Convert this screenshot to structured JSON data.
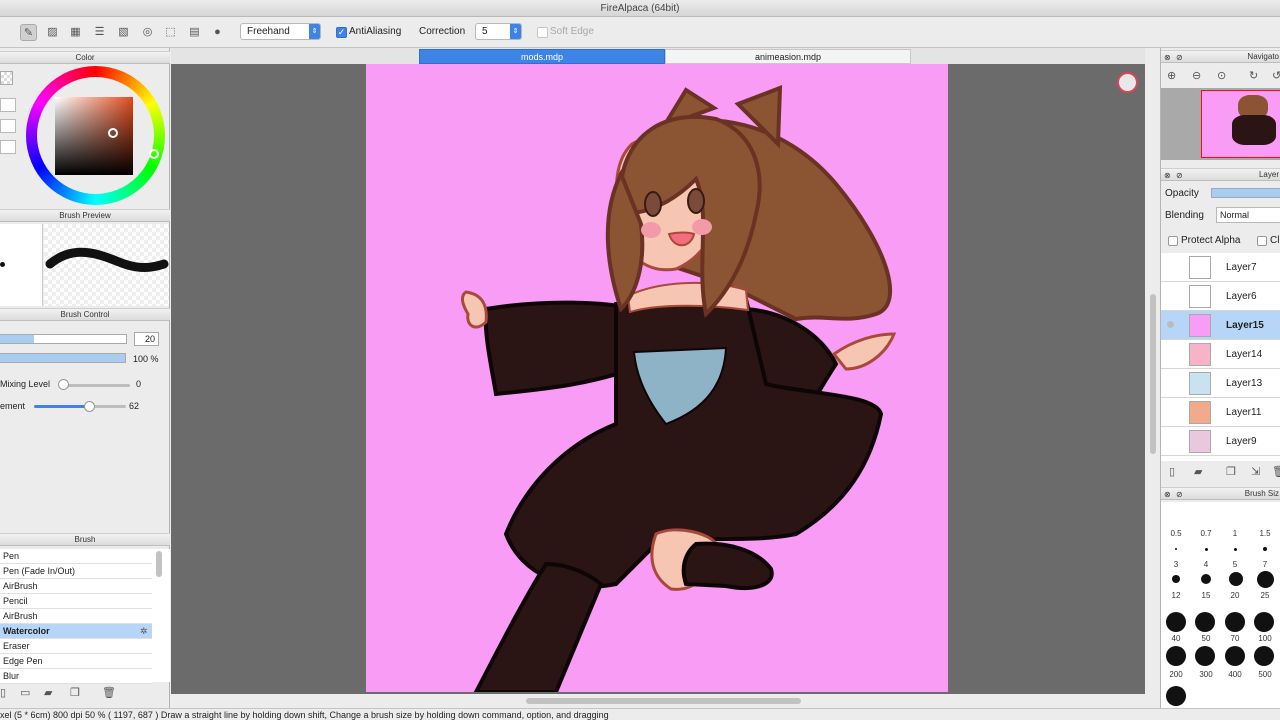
{
  "app": {
    "title": "FireAlpaca (64bit)"
  },
  "toolbar": {
    "mode_select": "Freehand",
    "antialias_label": "AntiAliasing",
    "antialias_checked": true,
    "correction_label": "Correction",
    "correction_value": "5",
    "soft_edge_label": "Soft Edge",
    "soft_edge_checked": false
  },
  "tabs": [
    {
      "label": "mods.mdp",
      "active": true
    },
    {
      "label": "animeasion.mdp",
      "active": false
    }
  ],
  "left": {
    "color_title": "Color",
    "brush_preview_title": "Brush Preview",
    "brush_control_title": "Brush Control",
    "brush_size_value": "20",
    "opacity_value": "100 %",
    "mixing_label": "Mixing Level",
    "mixing_value": "0",
    "ement_label": "ement",
    "ement_value": "62",
    "brush_title": "Brush",
    "brushes": [
      {
        "label": "Pen",
        "selected": false
      },
      {
        "label": "Pen (Fade In/Out)",
        "selected": false
      },
      {
        "label": "AirBrush",
        "selected": false
      },
      {
        "label": "Pencil",
        "selected": false
      },
      {
        "label": "AirBrush",
        "selected": false
      },
      {
        "label": "Watercolor",
        "selected": true
      },
      {
        "label": "Eraser",
        "selected": false
      },
      {
        "label": "Edge Pen",
        "selected": false
      },
      {
        "label": "Blur",
        "selected": false
      }
    ]
  },
  "right": {
    "navigator_title": "Navigato",
    "layer_title": "Layer",
    "opacity_label": "Opacity",
    "blending_label": "Blending",
    "blending_value": "Normal",
    "protect_alpha_label": "Protect Alpha",
    "clipping_label": "Clipp",
    "layers": [
      {
        "name": "Layer7",
        "selected": false
      },
      {
        "name": "Layer6",
        "selected": false
      },
      {
        "name": "Layer15",
        "selected": true
      },
      {
        "name": "Layer14",
        "selected": false
      },
      {
        "name": "Layer13",
        "selected": false
      },
      {
        "name": "Layer11",
        "selected": false
      },
      {
        "name": "Layer9",
        "selected": false
      }
    ],
    "brush_size_title": "Brush Siz",
    "brush_sizes": [
      "0.5",
      "0.7",
      "1",
      "1.5",
      "3",
      "4",
      "5",
      "7",
      "12",
      "15",
      "20",
      "25",
      "40",
      "50",
      "70",
      "100",
      "200",
      "300",
      "400",
      "500"
    ]
  },
  "status": {
    "text": "xel   (5 * 6cm)  800 dpi  50 %  ( 1197, 687 )  Draw a straight line by holding down shift, Change a brush size by holding down command, option, and dragging"
  },
  "colors": {
    "accent": "#3d84e6",
    "canvas_bg": "#f89cf5",
    "workspace": "#6b6b6b",
    "hair": "#8b5533",
    "dress": "#2a1414",
    "skin": "#f7c6b2",
    "chest": "#8fb3c6"
  }
}
